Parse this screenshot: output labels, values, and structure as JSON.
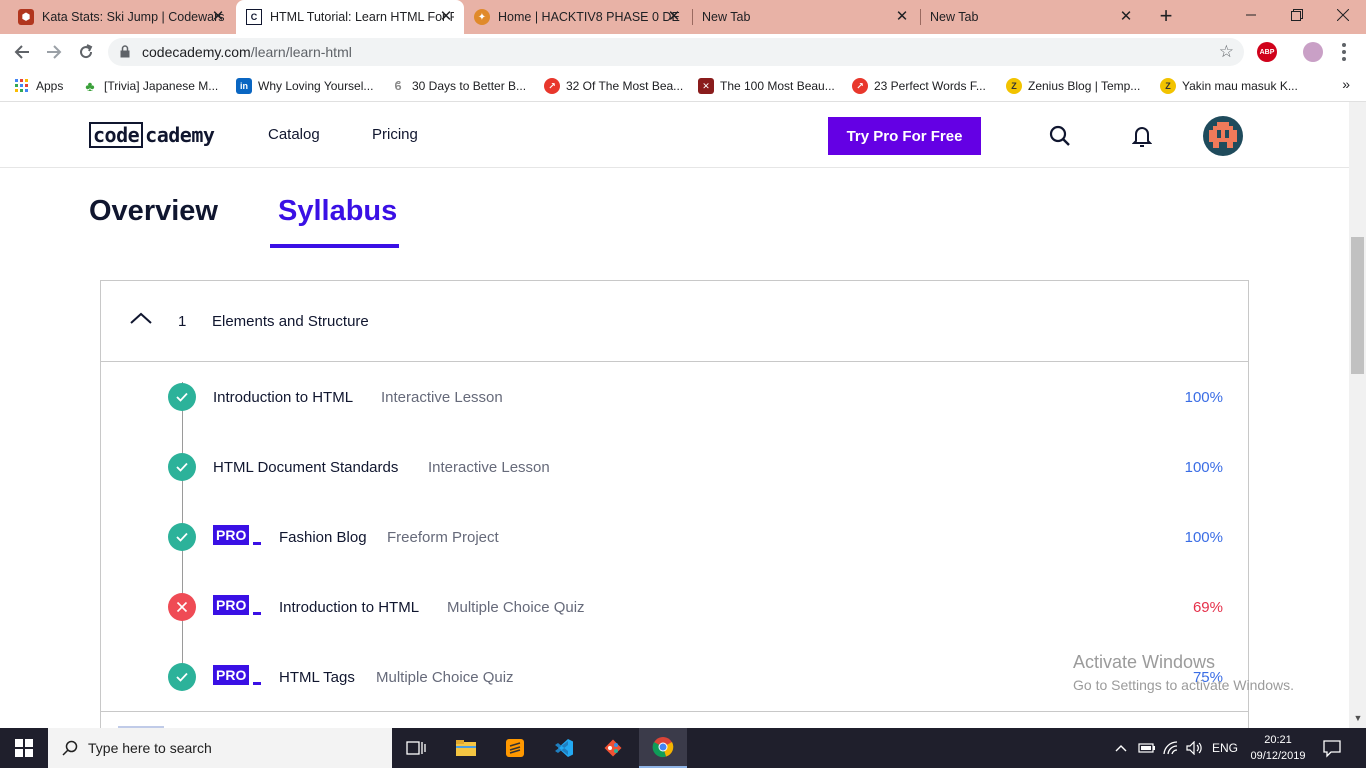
{
  "browser": {
    "tabs": [
      {
        "title": "Kata Stats: Ski Jump | Codewars",
        "active": false
      },
      {
        "title": "HTML Tutorial: Learn HTML For Free",
        "active": true
      },
      {
        "title": "Home | HACKTIV8 PHASE 0 DE",
        "active": false
      },
      {
        "title": "New Tab",
        "active": false
      },
      {
        "title": "New Tab",
        "active": false
      }
    ],
    "tab_close_glyph": "✕",
    "url_domain": "codecademy.com",
    "url_path": "/learn/learn-html",
    "abp_label": "ABP",
    "bookmarks": [
      {
        "label": "Apps",
        "icon": "apps-grid-icon"
      },
      {
        "label": "[Trivia] Japanese M...",
        "icon": "clover-icon"
      },
      {
        "label": "Why Loving Yoursel...",
        "icon": "linkedin-icon"
      },
      {
        "label": "30 Days to Better B...",
        "icon": "butterfly-icon"
      },
      {
        "label": "32 Of The Most Bea...",
        "icon": "trending-icon"
      },
      {
        "label": "The 100 Most Beau...",
        "icon": "pattern-icon"
      },
      {
        "label": "23 Perfect Words F...",
        "icon": "trending-icon"
      },
      {
        "label": "Zenius Blog | Temp...",
        "icon": "zenius-icon"
      },
      {
        "label": "Yakin mau masuk K...",
        "icon": "zenius-icon"
      }
    ],
    "bookmarks_more": "»"
  },
  "site": {
    "logo_boxed": "code",
    "logo_rest": "cademy",
    "nav": {
      "catalog": "Catalog",
      "pricing": "Pricing"
    },
    "cta": "Try Pro For Free",
    "brand_color": "#6400e4"
  },
  "page": {
    "tabs": {
      "overview": "Overview",
      "syllabus": "Syllabus"
    },
    "active_tab": "Syllabus",
    "module": {
      "number": "1",
      "title": "Elements and Structure",
      "expanded": true
    },
    "items": [
      {
        "title": "Introduction to HTML",
        "type": "Interactive Lesson",
        "progress": "100%",
        "status": "complete",
        "pro": false
      },
      {
        "title": "HTML Document Standards",
        "type": "Interactive Lesson",
        "progress": "100%",
        "status": "complete",
        "pro": false
      },
      {
        "title": "Fashion Blog",
        "type": "Freeform Project",
        "progress": "100%",
        "status": "complete",
        "pro": true
      },
      {
        "title": "Introduction to HTML",
        "type": "Multiple Choice Quiz",
        "progress": "69%",
        "status": "failed",
        "pro": true
      },
      {
        "title": "HTML Tags",
        "type": "Multiple Choice Quiz",
        "progress": "75%",
        "status": "complete",
        "pro": true
      }
    ],
    "pro_label": "PRO"
  },
  "watermark": {
    "line1": "Activate Windows",
    "line2": "Go to Settings to activate Windows."
  },
  "taskbar": {
    "search_placeholder": "Type here to search",
    "language": "ENG",
    "time": "20:21",
    "date": "09/12/2019"
  },
  "colors": {
    "accent": "#3a10e5",
    "success": "#2cb29a",
    "error": "#ef4b55",
    "tab_strip": "#e8b2a6"
  }
}
